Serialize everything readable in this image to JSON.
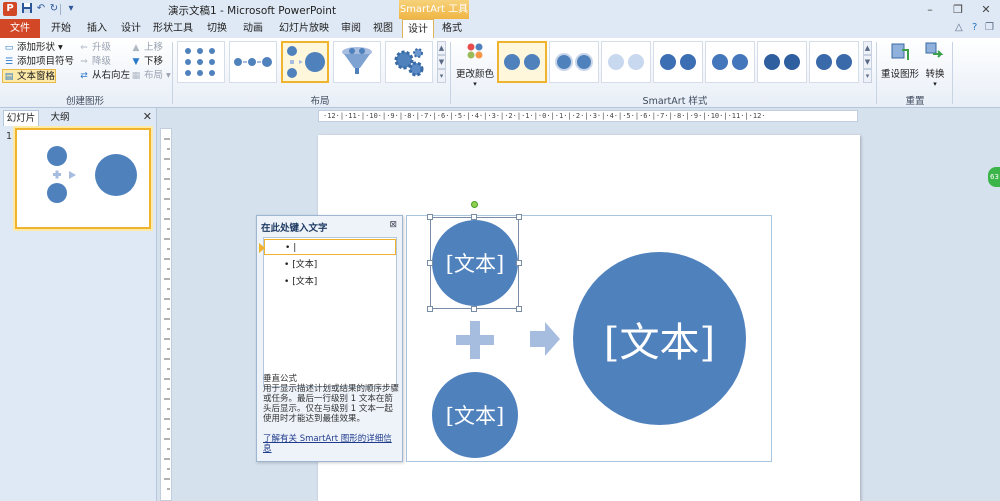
{
  "titlebar": {
    "app_icon_letter": "P",
    "doc_title": "演示文稿1 - Microsoft PowerPoint",
    "context_title": "SmartArt 工具",
    "window_buttons": {
      "minimize": "–",
      "restore": "❐",
      "close": "✕"
    },
    "quick_access_icons": [
      "save-icon",
      "undo-icon",
      "redo-icon",
      "customize-icon"
    ]
  },
  "tabs": [
    "文件",
    "开始",
    "插入",
    "设计",
    "形状工具",
    "切换",
    "动画",
    "幻灯片放映",
    "审阅",
    "视图",
    "设计",
    "格式"
  ],
  "ribbon": {
    "create_graphic": {
      "label": "创建图形",
      "add_shape": "添加形状",
      "add_bullet": "添加项目符号",
      "text_pane": "文本窗格",
      "promote": "升级",
      "demote": "降级",
      "right_to_left": "从右向左",
      "move_up": "上移",
      "move_down": "下移",
      "layout": "布局"
    },
    "layouts": {
      "label": "布局"
    },
    "styles": {
      "label": "SmartArt 样式",
      "change_colors": "更改颜色"
    },
    "reset": {
      "label": "重置",
      "reset_graphic": "重设图形",
      "convert": "转换"
    }
  },
  "left_panel": {
    "tab_slides": "幻灯片",
    "tab_outline": "大纲",
    "close": "✕",
    "slide_number": "1"
  },
  "ruler": {
    "horizontal": "·12·|·11·|·10·|·9·|·8·|·7·|·6·|·5·|·4·|·3·|·2·|·1·|·0·|·1·|·2·|·3·|·4·|·5·|·6·|·7·|·8·|·9·|·10·|·11·|·12·"
  },
  "smartart": {
    "shape_text_1": "[文本]",
    "shape_text_2": "[文本]",
    "shape_text_3": "[文本]"
  },
  "text_pane": {
    "title": "在此处键入文字",
    "close": "⊠",
    "bullets": [
      "",
      "[文本]",
      "[文本]"
    ],
    "caret": "|",
    "desc_title": "垂直公式",
    "description": "用于显示描述计划或结果的顺序步骤或任务。最后一行级别 1 文本在箭头后显示。仅在与级别 1 文本一起使用时才能达到最佳效果。",
    "learn_more": "了解有关 SmartArt 图形的详细信息"
  },
  "colors": {
    "shape_blue": "#4f81bd",
    "arrow_blue": "#a7bde0",
    "selection_orange": "#f0b32e",
    "file_tab_red": "#d24726"
  }
}
